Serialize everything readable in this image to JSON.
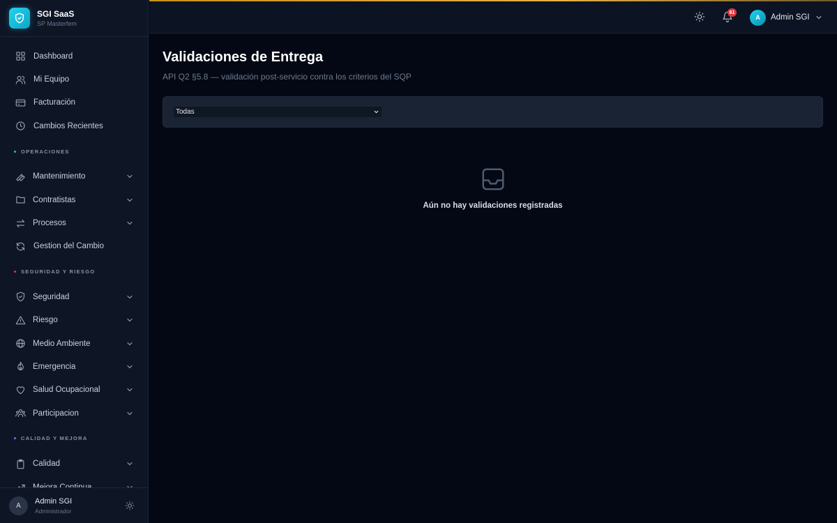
{
  "brand": {
    "name": "SGI SaaS",
    "subtitle": "SP Masterfem"
  },
  "sidebar": {
    "top_items": [
      {
        "label": "Dashboard",
        "icon": "grid-icon"
      },
      {
        "label": "Mi Equipo",
        "icon": "users-icon"
      },
      {
        "label": "Facturación",
        "icon": "credit-card-icon"
      },
      {
        "label": "Cambios Recientes",
        "icon": "clock-icon"
      }
    ],
    "sections": [
      {
        "title": "OPERACIONES",
        "dot_color": "#22b8cf",
        "items": [
          {
            "label": "Mantenimiento",
            "icon": "wrench-icon",
            "expandable": true
          },
          {
            "label": "Contratistas",
            "icon": "folder-icon",
            "expandable": true
          },
          {
            "label": "Procesos",
            "icon": "arrows-swap-icon",
            "expandable": true
          },
          {
            "label": "Gestion del Cambio",
            "icon": "refresh-icon",
            "expandable": false
          }
        ]
      },
      {
        "title": "SEGURIDAD Y RIESGO",
        "dot_color": "#e0383e",
        "items": [
          {
            "label": "Seguridad",
            "icon": "shield-check-icon",
            "expandable": true
          },
          {
            "label": "Riesgo",
            "icon": "warning-triangle-icon",
            "expandable": true
          },
          {
            "label": "Medio Ambiente",
            "icon": "globe-icon",
            "expandable": true
          },
          {
            "label": "Emergencia",
            "icon": "flame-icon",
            "expandable": true
          },
          {
            "label": "Salud Ocupacional",
            "icon": "heart-icon",
            "expandable": true
          },
          {
            "label": "Participacion",
            "icon": "people-group-icon",
            "expandable": true
          }
        ]
      },
      {
        "title": "CALIDAD Y MEJORA",
        "dot_color": "#7c6cf0",
        "items": [
          {
            "label": "Calidad",
            "icon": "clipboard-icon",
            "expandable": true
          },
          {
            "label": "Mejora Continua",
            "icon": "trend-up-icon",
            "expandable": true
          }
        ]
      }
    ],
    "footer": {
      "avatar_initial": "A",
      "name": "Admin SGI",
      "role": "Administrador"
    }
  },
  "topbar": {
    "notification_count": "61",
    "user": {
      "avatar_initial": "A",
      "name": "Admin SGI"
    },
    "accent_color": "#e8b04a"
  },
  "main": {
    "title": "Validaciones de Entrega",
    "subtitle": "API Q2 §5.8 — validación post-servicio contra los criterios del SQP",
    "filter": {
      "selected": "Todas"
    },
    "empty_state": {
      "icon": "inbox-icon",
      "message": "Aún no hay validaciones registradas"
    }
  }
}
